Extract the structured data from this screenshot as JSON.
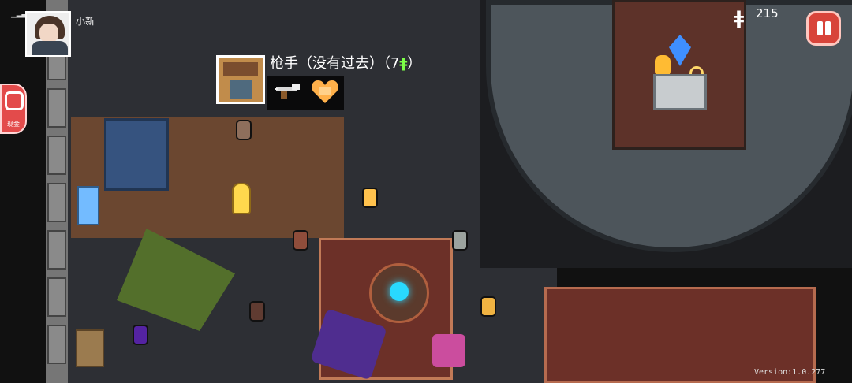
{
  "hud": {
    "status_icon": "signal-bars",
    "username": "小新",
    "currency": 215,
    "currency_icon": "hegemony-credit-icon",
    "pause_icon": "pause-icon",
    "side_widget_text": "现金"
  },
  "tooltip": {
    "title": "枪手（没有过去）",
    "price_prefix": "（",
    "price_value": "7",
    "price_suffix": "）",
    "portrait_icon": "gunslinger-portrait-icon",
    "items": [
      {
        "icon": "revolver-icon"
      },
      {
        "icon": "heart-shield-icon"
      }
    ]
  },
  "footer": {
    "version": "Version:1.0.277"
  }
}
